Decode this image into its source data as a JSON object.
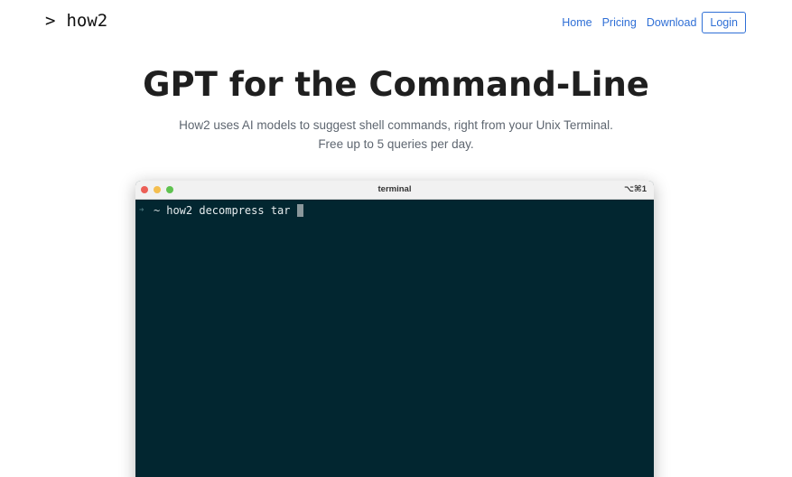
{
  "header": {
    "logo_prompt": ">",
    "logo_text": "how2",
    "nav": {
      "home": "Home",
      "pricing": "Pricing",
      "download": "Download",
      "login": "Login"
    }
  },
  "hero": {
    "title": "GPT for the Command-Line",
    "subtitle_line1": "How2 uses AI models to suggest shell commands, right from your Unix Terminal.",
    "subtitle_line2": "Free up to 5 queries per day."
  },
  "terminal": {
    "title": "terminal",
    "shortcut": "⌥⌘1",
    "prompt_arrow": "➜",
    "prompt_dir": "~",
    "command": "how2 decompress tar"
  },
  "colors": {
    "accent": "#2f6fd6",
    "terminal_bg": "#022630",
    "dot_red": "#ec5f57",
    "dot_yellow": "#f4be4f",
    "dot_green": "#5fc24f"
  }
}
